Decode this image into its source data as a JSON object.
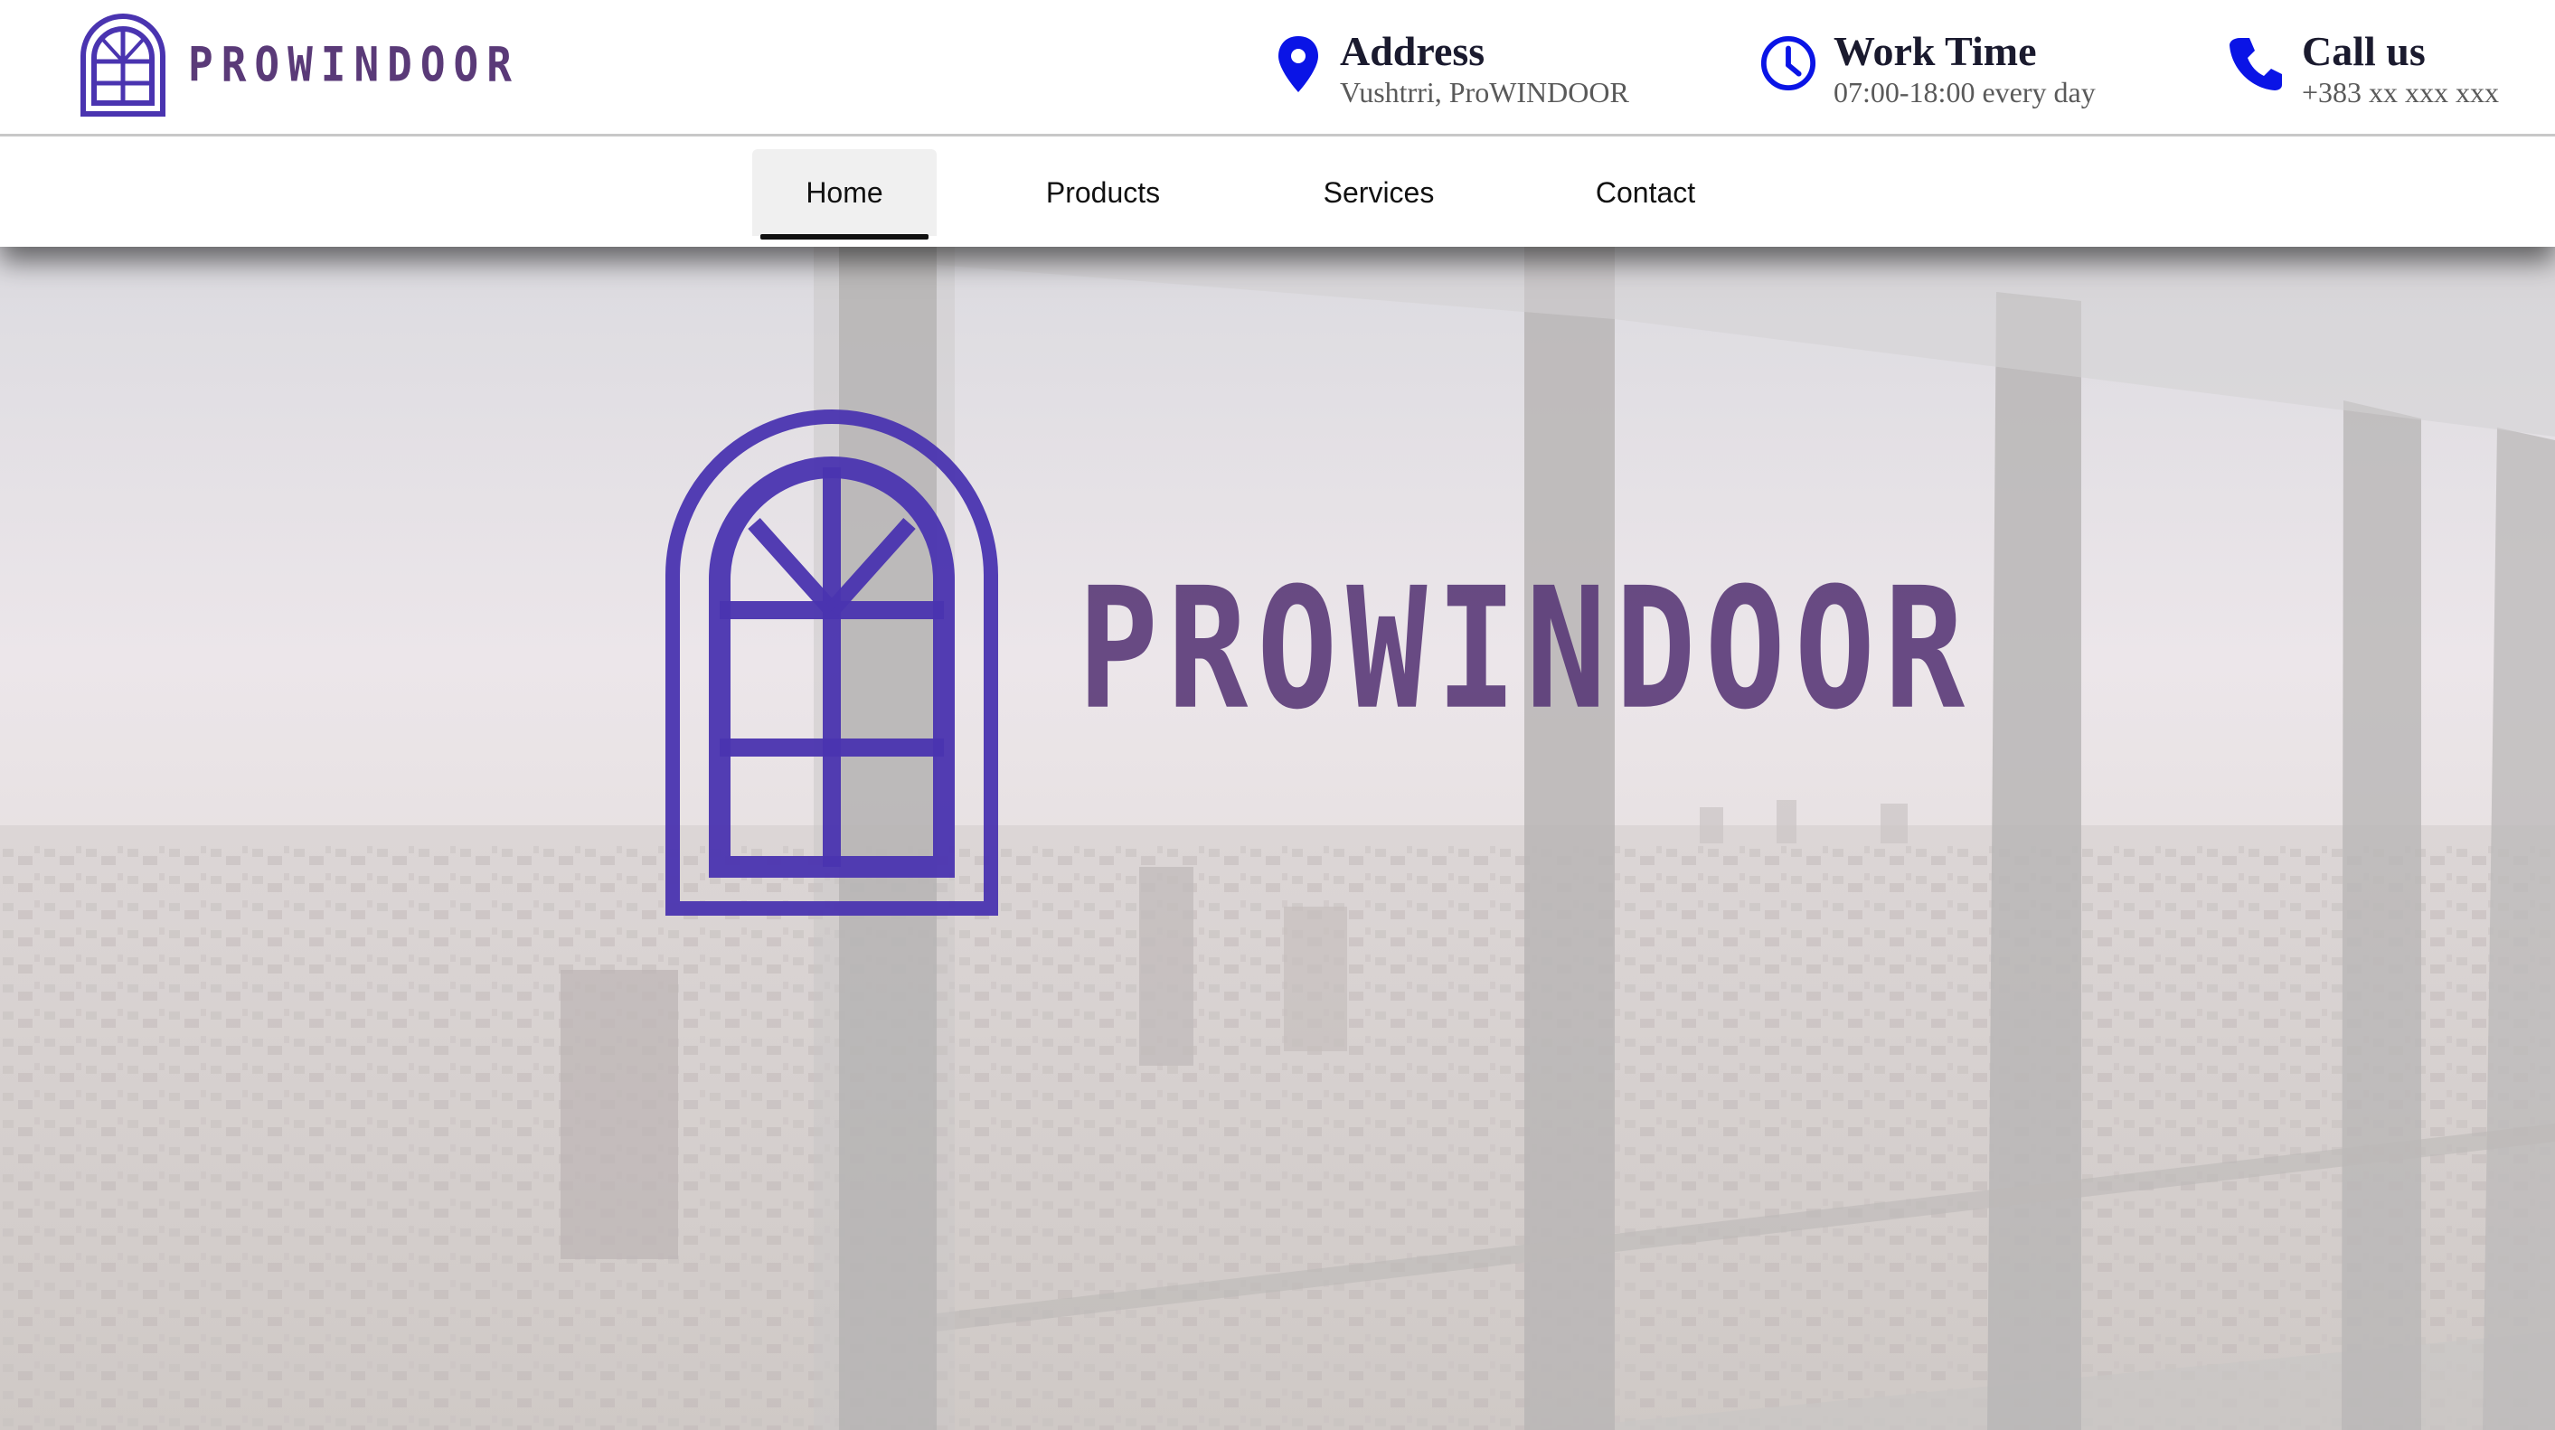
{
  "header": {
    "logo_text": "PROWINDOOR",
    "address": {
      "title": "Address",
      "value": "Vushtrri, ProWINDOOR",
      "icon": "location-pin-icon"
    },
    "work_time": {
      "title": "Work Time",
      "value": "07:00-18:00 every day",
      "icon": "clock-icon"
    },
    "call_us": {
      "title": "Call us",
      "value": "+383 xx xxx xxx",
      "icon": "phone-icon"
    }
  },
  "nav": {
    "items": [
      {
        "label": "Home",
        "active": true
      },
      {
        "label": "Products",
        "active": false
      },
      {
        "label": "Services",
        "active": false
      },
      {
        "label": "Contact",
        "active": false
      }
    ]
  },
  "hero": {
    "logo_text": "PROWINDOOR"
  },
  "colors": {
    "brand_purple": "#4a34b0",
    "wordmark_purple": "#5a3a78",
    "icon_blue": "#0a14e6",
    "nav_active_bg": "#f0f0f0"
  }
}
